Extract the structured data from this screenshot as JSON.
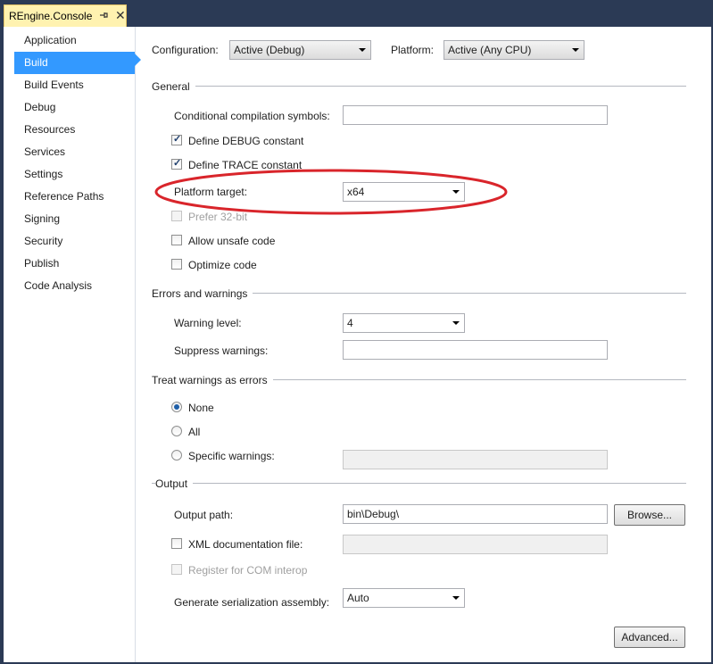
{
  "tab": {
    "title": "REngine.Console"
  },
  "sidebar": {
    "items": [
      {
        "label": "Application"
      },
      {
        "label": "Build"
      },
      {
        "label": "Build Events"
      },
      {
        "label": "Debug"
      },
      {
        "label": "Resources"
      },
      {
        "label": "Services"
      },
      {
        "label": "Settings"
      },
      {
        "label": "Reference Paths"
      },
      {
        "label": "Signing"
      },
      {
        "label": "Security"
      },
      {
        "label": "Publish"
      },
      {
        "label": "Code Analysis"
      }
    ],
    "active_index": 1
  },
  "top": {
    "configuration_label": "Configuration:",
    "configuration_value": "Active (Debug)",
    "platform_label": "Platform:",
    "platform_value": "Active (Any CPU)"
  },
  "general": {
    "title": "General",
    "cond_symbols_label": "Conditional compilation symbols:",
    "cond_symbols_value": "",
    "define_debug_label": "Define DEBUG constant",
    "define_debug_checked": true,
    "define_trace_label": "Define TRACE constant",
    "define_trace_checked": true,
    "platform_target_label": "Platform target:",
    "platform_target_value": "x64",
    "prefer32_label": "Prefer 32-bit",
    "prefer32_checked": false,
    "unsafe_label": "Allow unsafe code",
    "unsafe_checked": false,
    "optimize_label": "Optimize code",
    "optimize_checked": false
  },
  "errors": {
    "title": "Errors and warnings",
    "warning_level_label": "Warning level:",
    "warning_level_value": "4",
    "suppress_label": "Suppress warnings:",
    "suppress_value": ""
  },
  "treat": {
    "title": "Treat warnings as errors",
    "none_label": "None",
    "all_label": "All",
    "specific_label": "Specific warnings:",
    "selected": "None",
    "specific_value": ""
  },
  "output": {
    "title": "Output",
    "path_label": "Output path:",
    "path_value": "bin\\Debug\\",
    "browse_label": "Browse...",
    "xml_label": "XML documentation file:",
    "xml_checked": false,
    "xml_value": "",
    "com_label": "Register for COM interop",
    "com_checked": false,
    "serialization_label": "Generate serialization assembly:",
    "serialization_value": "Auto",
    "advanced_label": "Advanced..."
  },
  "colors": {
    "accent": "#3399ff",
    "tab_background": "#fff2b0",
    "annotation": "#d9252b"
  }
}
